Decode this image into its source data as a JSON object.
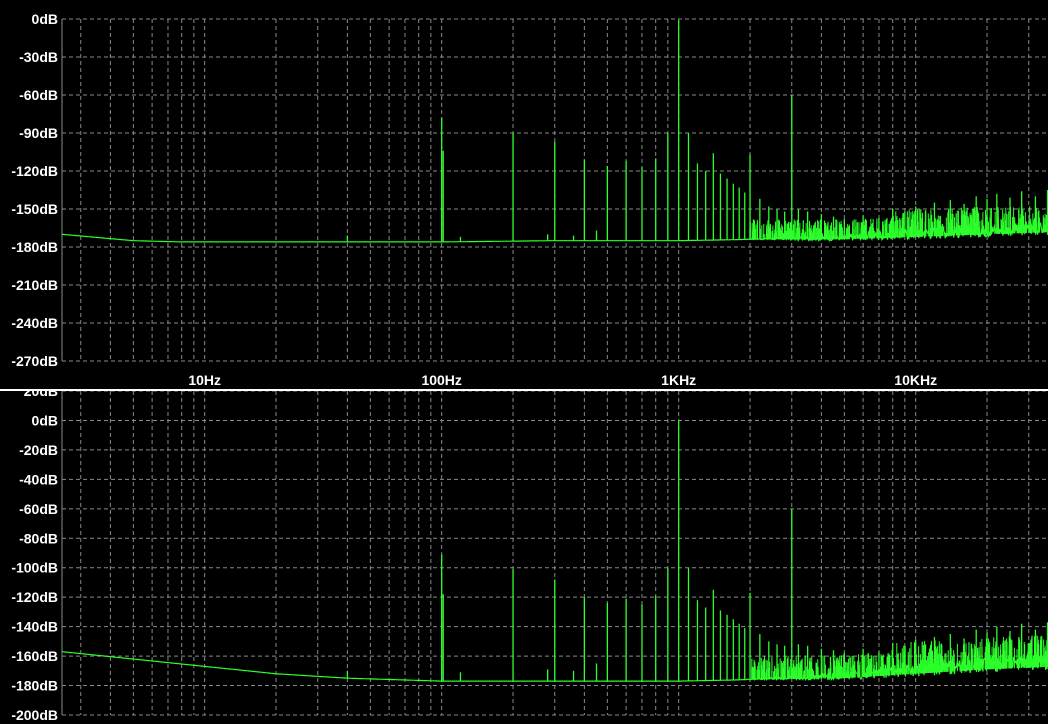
{
  "colors": {
    "background": "#000000",
    "grid": "#8a8a8a",
    "trace": "#2cff2c",
    "axis_text": "#ffffff",
    "divider": "#ffffff"
  },
  "chart_data": [
    {
      "type": "line",
      "x_scale": "log",
      "x_unit": "Hz",
      "xlim": [
        2.5,
        40000
      ],
      "ylim": [
        -270,
        0
      ],
      "grid": true,
      "y_ticks": [
        0,
        -30,
        -60,
        -90,
        -120,
        -150,
        -180,
        -210,
        -240,
        -270
      ],
      "y_tick_labels": [
        "0dB",
        "-30dB",
        "-60dB",
        "-90dB",
        "-120dB",
        "-150dB",
        "-180dB",
        "-210dB",
        "-240dB",
        "-270dB"
      ],
      "x_ticks": [
        10,
        100,
        1000,
        10000
      ],
      "x_tick_labels": [
        "10Hz",
        "100Hz",
        "1KHz",
        "10KHz"
      ],
      "noise_floor": [
        [
          2.5,
          -170
        ],
        [
          5,
          -175
        ],
        [
          8,
          -176
        ],
        [
          20,
          -176
        ],
        [
          40,
          -176
        ],
        [
          100,
          -176
        ],
        [
          300,
          -175
        ],
        [
          1000,
          -175
        ],
        [
          2000,
          -174
        ],
        [
          5000,
          -174
        ],
        [
          10000,
          -172
        ],
        [
          20000,
          -170
        ],
        [
          40000,
          -168
        ]
      ],
      "peaks": [
        {
          "x": 40,
          "y": -171
        },
        {
          "x": 100,
          "y": -78
        },
        {
          "x": 101.5,
          "y": -104
        },
        {
          "x": 120,
          "y": -172
        },
        {
          "x": 200,
          "y": -90
        },
        {
          "x": 280,
          "y": -170
        },
        {
          "x": 300,
          "y": -97
        },
        {
          "x": 360,
          "y": -171
        },
        {
          "x": 400,
          "y": -111
        },
        {
          "x": 450,
          "y": -167
        },
        {
          "x": 500,
          "y": -116
        },
        {
          "x": 600,
          "y": -112
        },
        {
          "x": 700,
          "y": -117
        },
        {
          "x": 800,
          "y": -110
        },
        {
          "x": 900,
          "y": -90
        },
        {
          "x": 1000,
          "y": -1
        },
        {
          "x": 1100,
          "y": -90
        },
        {
          "x": 1200,
          "y": -114
        },
        {
          "x": 1300,
          "y": -120
        },
        {
          "x": 1400,
          "y": -106
        },
        {
          "x": 1500,
          "y": -122
        },
        {
          "x": 1600,
          "y": -126
        },
        {
          "x": 1700,
          "y": -130
        },
        {
          "x": 1800,
          "y": -133
        },
        {
          "x": 1900,
          "y": -137
        },
        {
          "x": 2000,
          "y": -107
        },
        {
          "x": 2200,
          "y": -142
        },
        {
          "x": 2400,
          "y": -148
        },
        {
          "x": 2600,
          "y": -150
        },
        {
          "x": 2800,
          "y": -152
        },
        {
          "x": 3000,
          "y": -60
        },
        {
          "x": 3200,
          "y": -150
        },
        {
          "x": 3500,
          "y": -152
        },
        {
          "x": 4000,
          "y": -154
        },
        {
          "x": 4500,
          "y": -156
        },
        {
          "x": 5000,
          "y": -158
        },
        {
          "x": 6000,
          "y": -155
        },
        {
          "x": 7000,
          "y": -157
        },
        {
          "x": 8000,
          "y": -150
        },
        {
          "x": 9000,
          "y": -152
        },
        {
          "x": 10000,
          "y": -148
        },
        {
          "x": 11000,
          "y": -151
        },
        {
          "x": 12000,
          "y": -145
        },
        {
          "x": 14000,
          "y": -143
        },
        {
          "x": 16000,
          "y": -146
        },
        {
          "x": 18000,
          "y": -140
        },
        {
          "x": 20000,
          "y": -142
        },
        {
          "x": 22000,
          "y": -138
        },
        {
          "x": 25000,
          "y": -141
        },
        {
          "x": 28000,
          "y": -136
        },
        {
          "x": 32000,
          "y": -140
        },
        {
          "x": 36000,
          "y": -135
        },
        {
          "x": 40000,
          "y": -139
        }
      ]
    },
    {
      "type": "line",
      "x_scale": "log",
      "x_unit": "Hz",
      "xlim": [
        2.5,
        40000
      ],
      "ylim": [
        -200,
        20
      ],
      "grid": true,
      "y_ticks": [
        20,
        0,
        -20,
        -40,
        -60,
        -80,
        -100,
        -120,
        -140,
        -160,
        -180,
        -200
      ],
      "y_tick_labels": [
        "20dB",
        "0dB",
        "-20dB",
        "-40dB",
        "-60dB",
        "-80dB",
        "-100dB",
        "-120dB",
        "-140dB",
        "-160dB",
        "-180dB",
        "-200dB"
      ],
      "noise_floor": [
        [
          2.5,
          -157
        ],
        [
          5,
          -162
        ],
        [
          10,
          -167
        ],
        [
          20,
          -172
        ],
        [
          40,
          -175
        ],
        [
          100,
          -177
        ],
        [
          300,
          -177
        ],
        [
          1000,
          -177
        ],
        [
          2000,
          -176
        ],
        [
          5000,
          -175
        ],
        [
          10000,
          -172
        ],
        [
          20000,
          -169
        ],
        [
          40000,
          -167
        ]
      ],
      "peaks": [
        {
          "x": 40,
          "y": -170
        },
        {
          "x": 100,
          "y": -91
        },
        {
          "x": 101.5,
          "y": -118
        },
        {
          "x": 120,
          "y": -171
        },
        {
          "x": 200,
          "y": -101
        },
        {
          "x": 280,
          "y": -169
        },
        {
          "x": 300,
          "y": -108
        },
        {
          "x": 360,
          "y": -170
        },
        {
          "x": 400,
          "y": -120
        },
        {
          "x": 450,
          "y": -165
        },
        {
          "x": 500,
          "y": -124
        },
        {
          "x": 600,
          "y": -121
        },
        {
          "x": 700,
          "y": -125
        },
        {
          "x": 800,
          "y": -119
        },
        {
          "x": 900,
          "y": -100
        },
        {
          "x": 1000,
          "y": 0
        },
        {
          "x": 1100,
          "y": -100
        },
        {
          "x": 1200,
          "y": -122
        },
        {
          "x": 1300,
          "y": -127
        },
        {
          "x": 1400,
          "y": -115
        },
        {
          "x": 1500,
          "y": -129
        },
        {
          "x": 1600,
          "y": -132
        },
        {
          "x": 1700,
          "y": -135
        },
        {
          "x": 1800,
          "y": -138
        },
        {
          "x": 1900,
          "y": -141
        },
        {
          "x": 2000,
          "y": -117
        },
        {
          "x": 2200,
          "y": -145
        },
        {
          "x": 2400,
          "y": -150
        },
        {
          "x": 2600,
          "y": -152
        },
        {
          "x": 2800,
          "y": -153
        },
        {
          "x": 3000,
          "y": -60
        },
        {
          "x": 3200,
          "y": -152
        },
        {
          "x": 3500,
          "y": -153
        },
        {
          "x": 4000,
          "y": -155
        },
        {
          "x": 4500,
          "y": -156
        },
        {
          "x": 5000,
          "y": -158
        },
        {
          "x": 6000,
          "y": -155
        },
        {
          "x": 7000,
          "y": -157
        },
        {
          "x": 8000,
          "y": -151
        },
        {
          "x": 9000,
          "y": -153
        },
        {
          "x": 10000,
          "y": -149
        },
        {
          "x": 11000,
          "y": -152
        },
        {
          "x": 12000,
          "y": -147
        },
        {
          "x": 14000,
          "y": -145
        },
        {
          "x": 16000,
          "y": -148
        },
        {
          "x": 18000,
          "y": -142
        },
        {
          "x": 20000,
          "y": -144
        },
        {
          "x": 22000,
          "y": -140
        },
        {
          "x": 25000,
          "y": -143
        },
        {
          "x": 28000,
          "y": -138
        },
        {
          "x": 32000,
          "y": -142
        },
        {
          "x": 36000,
          "y": -137
        },
        {
          "x": 40000,
          "y": -141
        }
      ]
    }
  ]
}
